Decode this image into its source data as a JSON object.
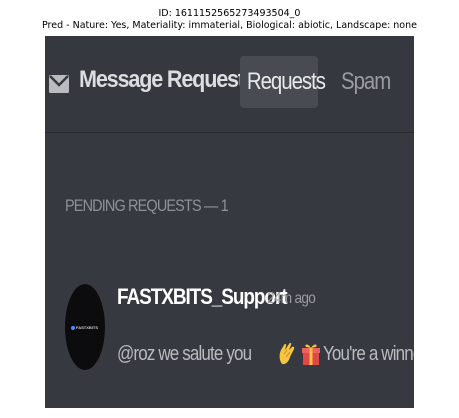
{
  "caption": {
    "line1": "ID: 1611152565273493504_0",
    "line2": "Pred - Nature: Yes, Materiality: immaterial, Biological: abiotic, Landscape: none"
  },
  "header": {
    "title": "Message Requests",
    "icon": "envelope-icon",
    "tabs": [
      {
        "label": "Requests",
        "active": true
      },
      {
        "label": "Spam",
        "active": false
      }
    ]
  },
  "pending": {
    "header": "PENDING REQUESTS — 1",
    "items": [
      {
        "username": "FASTXBITS_Support",
        "time": "24m ago",
        "avatar_text": "FASTXBITS",
        "message_part1": "@roz we salute you",
        "message_part2": "You're a winner!",
        "emojis": [
          "clapping-hands-emoji",
          "gift-emoji"
        ]
      }
    ]
  },
  "colors": {
    "background": "#36393f",
    "text_primary": "#ffffff",
    "text_muted": "#8e9297",
    "tab_active_bg": "#484b51"
  }
}
